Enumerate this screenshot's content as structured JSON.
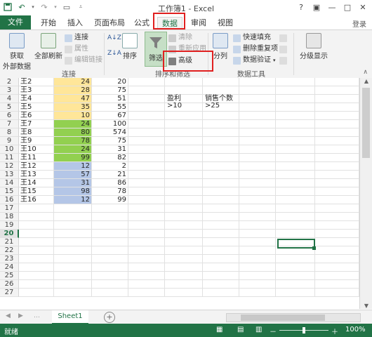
{
  "window": {
    "title": "工作簿1 - Excel",
    "help": "?",
    "restore": "▣",
    "minimize": "—",
    "maximize": "□",
    "close": "✕"
  },
  "qat": {
    "save_icon": "save-icon",
    "undo_icon": "undo-icon",
    "redo_icon": "redo-icon",
    "customize_icon": "customize-icon"
  },
  "tabs": {
    "file": "文件",
    "home": "开始",
    "insert": "插入",
    "layout": "页面布局",
    "formulas": "公式",
    "data": "数据",
    "review": "审阅",
    "view": "视图",
    "login": "登录"
  },
  "ribbon": {
    "get_external_line1": "获取",
    "get_external_line2": "外部数据",
    "refresh_all": "全部刷新",
    "connections": "连接",
    "properties": "属性",
    "edit_links": "编辑链接",
    "group_connections": "连接",
    "sort": "排序",
    "filter": "筛选",
    "clear": "清除",
    "reapply": "重新应用",
    "advanced": "高级",
    "group_sort_filter": "排序和筛选",
    "split": "分列",
    "flash_fill": "快速填充",
    "remove_dup": "删除重复项",
    "validation": "数据验证",
    "group_data_tools": "数据工具",
    "outline": "分级显示",
    "sort_az": "A↓Z",
    "sort_za": "Z↓A"
  },
  "sheet": {
    "rows": [
      {
        "n": "2",
        "a": "王2",
        "b": "24",
        "c": "20",
        "color": "#ffe699"
      },
      {
        "n": "3",
        "a": "王3",
        "b": "28",
        "c": "75",
        "color": "#ffe699"
      },
      {
        "n": "4",
        "a": "王4",
        "b": "47",
        "c": "51",
        "color": "#ffe699"
      },
      {
        "n": "5",
        "a": "王5",
        "b": "35",
        "c": "55",
        "color": "#ffe699"
      },
      {
        "n": "6",
        "a": "王6",
        "b": "10",
        "c": "67",
        "color": "#ffe699"
      },
      {
        "n": "7",
        "a": "王7",
        "b": "24",
        "c": "100",
        "color": "#92d050"
      },
      {
        "n": "8",
        "a": "王8",
        "b": "80",
        "c": "574",
        "color": "#92d050"
      },
      {
        "n": "9",
        "a": "王9",
        "b": "78",
        "c": "75",
        "color": "#92d050"
      },
      {
        "n": "10",
        "a": "王10",
        "b": "24",
        "c": "31",
        "color": "#92d050"
      },
      {
        "n": "11",
        "a": "王11",
        "b": "99",
        "c": "82",
        "color": "#92d050"
      },
      {
        "n": "12",
        "a": "王12",
        "b": "12",
        "c": "2",
        "color": "#b4c6e7"
      },
      {
        "n": "13",
        "a": "王13",
        "b": "57",
        "c": "21",
        "color": "#b4c6e7"
      },
      {
        "n": "14",
        "a": "王14",
        "b": "31",
        "c": "86",
        "color": "#b4c6e7"
      },
      {
        "n": "15",
        "a": "王15",
        "b": "98",
        "c": "78",
        "color": "#b4c6e7"
      },
      {
        "n": "16",
        "a": "王16",
        "b": "12",
        "c": "99",
        "color": "#b4c6e7"
      },
      {
        "n": "17"
      },
      {
        "n": "18"
      },
      {
        "n": "19"
      },
      {
        "n": "20"
      },
      {
        "n": "21"
      },
      {
        "n": "22"
      },
      {
        "n": "23"
      },
      {
        "n": "24"
      },
      {
        "n": "25"
      },
      {
        "n": "26"
      },
      {
        "n": "27"
      }
    ],
    "criteria_header_1": "盈利",
    "criteria_header_2": "销售个数",
    "criteria_value_1": ">10",
    "criteria_value_2": ">25",
    "selected_row": "20"
  },
  "sheet_tabs": {
    "active": "Sheet1",
    "add": "+",
    "nav_prev": "◀",
    "nav_next": "▶",
    "more": "…"
  },
  "status": {
    "ready": "就绪",
    "zoom": "100%",
    "zoom_minus": "－",
    "zoom_plus": "＋"
  }
}
